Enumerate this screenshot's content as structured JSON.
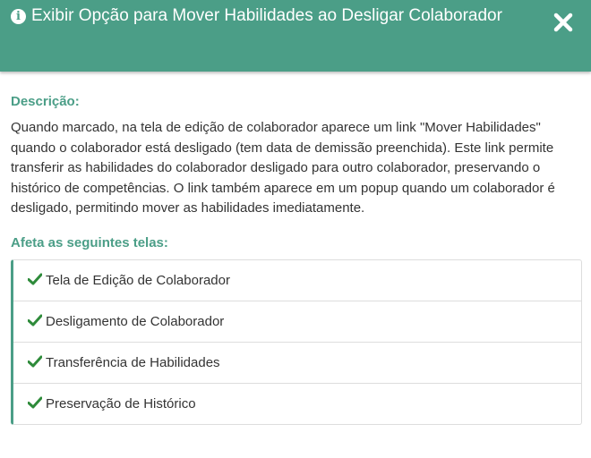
{
  "dialog": {
    "title": "Exibir Opção para Mover Habilidades ao Desligar Colaborador",
    "info_icon": "info-circle-icon",
    "close_icon": "close-icon",
    "accent_color": "#4b9e87"
  },
  "description": {
    "heading": "Descrição:",
    "text": "Quando marcado, na tela de edição de colaborador aparece um link \"Mover Habilidades\" quando o colaborador está desligado (tem data de demissão preenchida). Este link permite transferir as habilidades do colaborador desligado para outro colaborador, preservando o histórico de competências. O link também aparece em um popup quando um colaborador é desligado, permitindo mover as habilidades imediatamente."
  },
  "affects": {
    "heading": "Afeta as seguintes telas:",
    "check_icon": "check-icon",
    "check_color": "#2e8b3a",
    "items": [
      {
        "label": "Tela de Edição de Colaborador"
      },
      {
        "label": "Desligamento de Colaborador"
      },
      {
        "label": "Transferência de Habilidades"
      },
      {
        "label": "Preservação de Histórico"
      }
    ]
  }
}
